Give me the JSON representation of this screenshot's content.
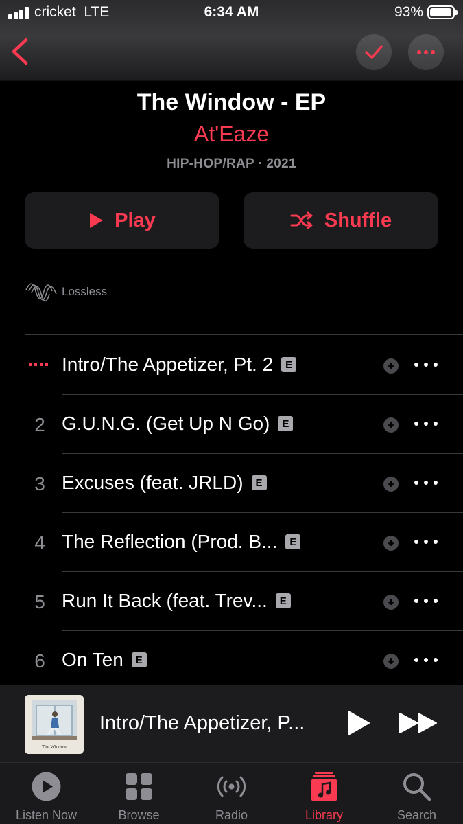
{
  "status_bar": {
    "carrier": "cricket",
    "network": "LTE",
    "time": "6:34 AM",
    "battery": "93%"
  },
  "nav": {
    "back_icon": "chevron-left-icon",
    "check_icon": "checkmark-icon",
    "more_icon": "ellipsis-icon"
  },
  "album": {
    "title": "The Window - EP",
    "artist": "At'Eaze",
    "meta": "HIP-HOP/RAP · 2021",
    "play_label": "Play",
    "shuffle_label": "Shuffle",
    "lossless_label": "Lossless"
  },
  "tracks": [
    {
      "number": "",
      "title": "Intro/The Appetizer, Pt. 2",
      "explicit": "E",
      "playing": true
    },
    {
      "number": "2",
      "title": "G.U.N.G. (Get Up N Go)",
      "explicit": "E"
    },
    {
      "number": "3",
      "title": "Excuses (feat. JRLD)",
      "explicit": "E"
    },
    {
      "number": "4",
      "title": "The Reflection (Prod. B...",
      "explicit": "E"
    },
    {
      "number": "5",
      "title": "Run It Back (feat. Trev...",
      "explicit": "E"
    },
    {
      "number": "6",
      "title": "On Ten",
      "explicit": "E"
    }
  ],
  "mini_player": {
    "title": "Intro/The Appetizer, P...",
    "art_caption": "The Window"
  },
  "tabs": [
    {
      "label": "Listen Now",
      "icon": "play-circle-icon"
    },
    {
      "label": "Browse",
      "icon": "grid-icon"
    },
    {
      "label": "Radio",
      "icon": "broadcast-icon"
    },
    {
      "label": "Library",
      "icon": "music-note-stack-icon",
      "active": true
    },
    {
      "label": "Search",
      "icon": "magnifier-icon"
    }
  ],
  "colors": {
    "accent": "#fa3a50",
    "background": "#000000",
    "secondary_text": "#8d8d93"
  }
}
